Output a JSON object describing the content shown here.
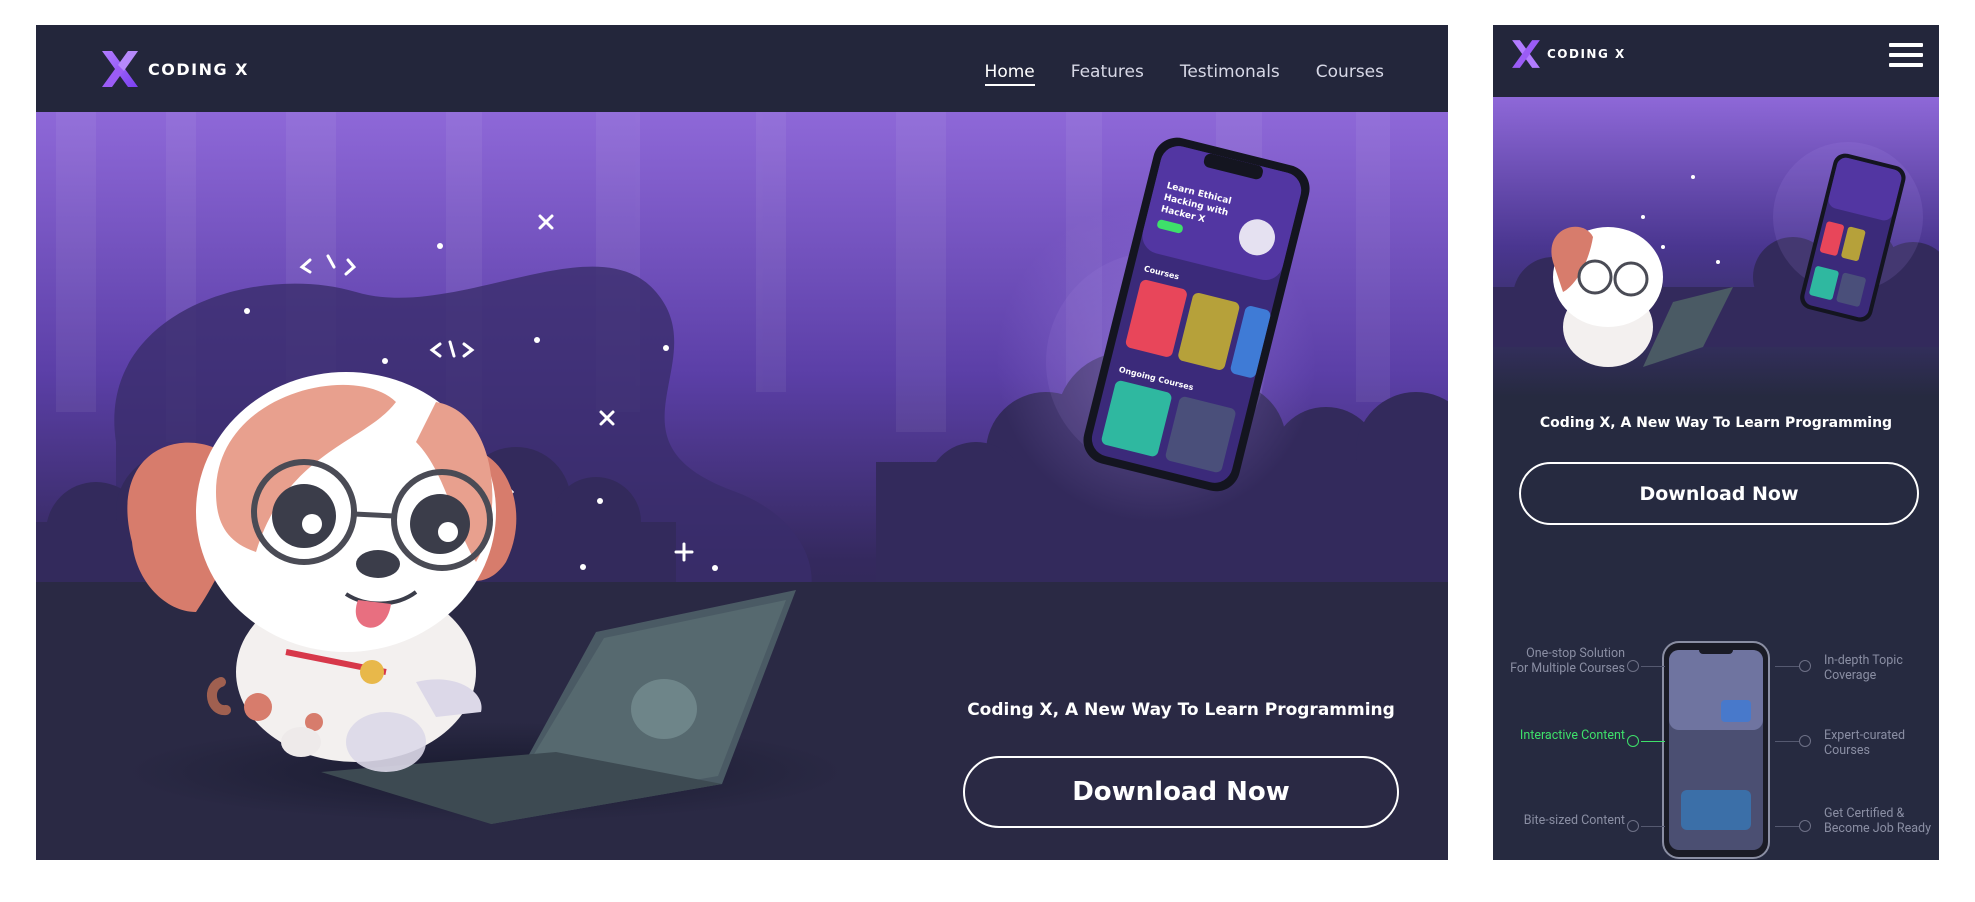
{
  "brand": {
    "name": "CODING X",
    "logo_mark": "X",
    "colors": {
      "mark": "#9b5cf6",
      "bg": "#262a40",
      "nav_bg": "#23263b",
      "hero_top": "#8e68d8",
      "accent_green": "#3ee06a"
    }
  },
  "desktop": {
    "nav": {
      "links": [
        {
          "label": "Home",
          "active": true
        },
        {
          "label": "Features",
          "active": false
        },
        {
          "label": "Testimonals",
          "active": false
        },
        {
          "label": "Courses",
          "active": false
        }
      ]
    },
    "hero": {
      "tagline": "Coding X, A New Way To Learn Programming",
      "download_label": "Download Now"
    }
  },
  "mobile": {
    "menu_icon": "hamburger-icon",
    "hero": {
      "tagline": "Coding X, A New Way To Learn Programming",
      "download_label": "Download Now"
    },
    "features": [
      {
        "label": "One-stop Solution For Multiple Courses",
        "side": "left",
        "highlight": false
      },
      {
        "label": "In-depth Topic Coverage",
        "side": "right",
        "highlight": false
      },
      {
        "label": "Interactive Content",
        "side": "left",
        "highlight": true
      },
      {
        "label": "Expert-curated Courses",
        "side": "right",
        "highlight": false
      },
      {
        "label": "Bite-sized Content",
        "side": "left",
        "highlight": false
      },
      {
        "label": "Get Certified & Become Job Ready",
        "side": "right",
        "highlight": false
      }
    ]
  },
  "phone_screen": {
    "header": "Learn Ethical Hacking with Hacker X",
    "sections": [
      "Courses",
      "Ongoing Courses"
    ]
  }
}
